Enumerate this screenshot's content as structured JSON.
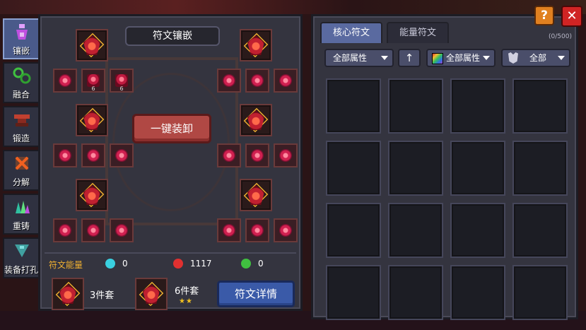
{
  "sidebar": {
    "items": [
      {
        "label": "镶嵌",
        "icon": "potion-icon",
        "active": true
      },
      {
        "label": "融合",
        "icon": "chain-icon",
        "active": false
      },
      {
        "label": "锻造",
        "icon": "anvil-icon",
        "active": false
      },
      {
        "label": "分解",
        "icon": "cross-hammer-icon",
        "active": false
      },
      {
        "label": "重铸",
        "icon": "crystal-icon",
        "active": false
      },
      {
        "label": "装备打孔",
        "icon": "drill-icon",
        "active": false
      }
    ]
  },
  "left_panel": {
    "title": "符文镶嵌",
    "unequip_label": "一键装卸",
    "slot_numbers": [
      "6",
      "6"
    ],
    "energy": {
      "label": "符文能量",
      "items": [
        {
          "icon": "blue-energy-icon",
          "value": "0",
          "color": "#3ad0e0"
        },
        {
          "icon": "red-energy-icon",
          "value": "1117",
          "color": "#e03030"
        },
        {
          "icon": "green-energy-icon",
          "value": "0",
          "color": "#40c040"
        }
      ]
    },
    "sets": [
      {
        "label": "3件套",
        "stars": ""
      },
      {
        "label": "6件套",
        "stars": "★★"
      }
    ],
    "detail_label": "符文详情"
  },
  "right_panel": {
    "tabs": [
      {
        "label": "核心符文",
        "active": true
      },
      {
        "label": "能量符文",
        "active": false
      }
    ],
    "count": "(0/500)",
    "filters": {
      "attribute_label": "全部属性",
      "sort_label": "↑",
      "color_label": "全部属性",
      "type_label": "全部"
    }
  },
  "buttons": {
    "help": "?",
    "close": "✕"
  },
  "colors": {
    "accent_orange": "#f0b030",
    "unequip_red": "#b04844",
    "detail_blue": "#3a5aa8",
    "close_red": "#d02424",
    "help_orange": "#e08020"
  }
}
